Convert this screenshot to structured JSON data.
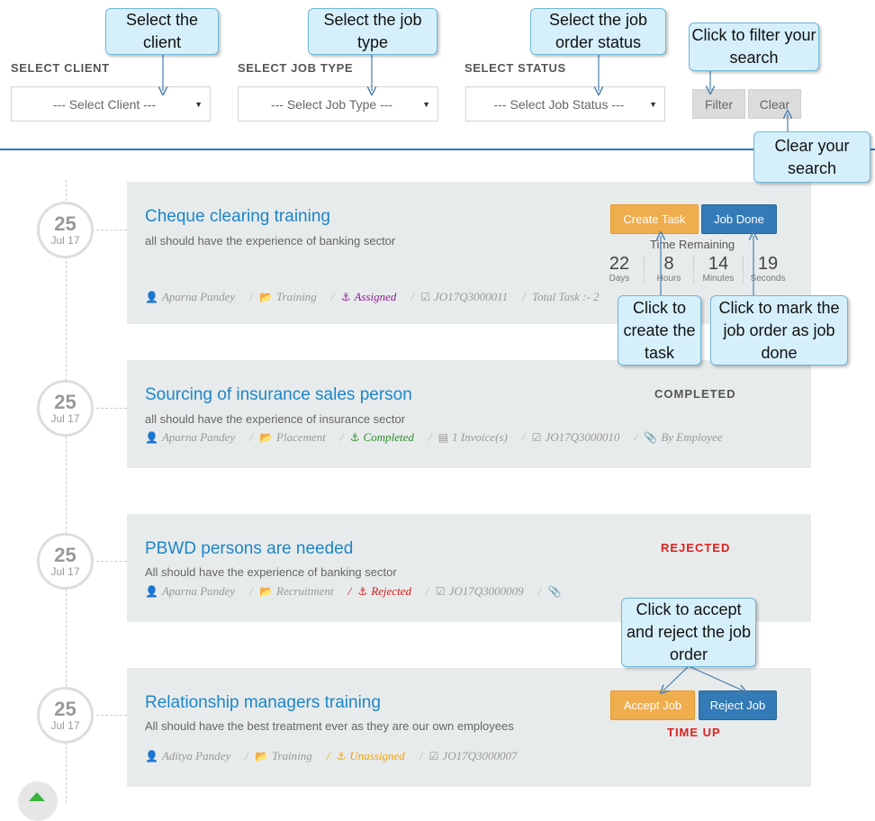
{
  "filters": {
    "client": {
      "label": "SELECT CLIENT",
      "value": "--- Select Client ---"
    },
    "job_type": {
      "label": "SELECT JOB TYPE",
      "value": "--- Select Job Type ---"
    },
    "status": {
      "label": "SELECT STATUS",
      "value": "--- Select Job Status ---"
    },
    "filter_label": "Filter",
    "clear_label": "Clear"
  },
  "callouts": {
    "client": "Select the client",
    "job_type": "Select  the job type",
    "status": "Select  the job order status",
    "filter": "Click to filter your search",
    "clear": "Clear your search",
    "create_task": "Click to create the task",
    "job_done": "Click to mark the job order as job done",
    "accept_reject": "Click to accept and reject the job order"
  },
  "jobs": [
    {
      "day": "25",
      "month": "Jul 17",
      "title": "Cheque clearing training",
      "description": "all should have the experience of banking sector",
      "meta": {
        "person": "Aparna Pandey",
        "type": "Training",
        "status": "Assigned",
        "code": "JO17Q3000011",
        "extra": "Total Task :- 2"
      },
      "status_color": "#8a1f8a",
      "actions": {
        "create_task": "Create Task",
        "job_done": "Job Done"
      },
      "timer": {
        "label": "Time Remaining",
        "units": [
          {
            "value": "22",
            "unit": "Days"
          },
          {
            "value": "8",
            "unit": "Hours"
          },
          {
            "value": "14",
            "unit": "Minutes"
          },
          {
            "value": "19",
            "unit": "Seconds"
          }
        ]
      }
    },
    {
      "day": "25",
      "month": "Jul 17",
      "title": "Sourcing of insurance sales person",
      "description": "all should have the experience of insurance sector",
      "meta": {
        "person": "Aparna Pandey",
        "type": "Placement",
        "status": "Completed",
        "invoice": "1 Invoice(s)",
        "code": "JO17Q3000010",
        "by": "By Employee"
      },
      "status_color": "#2e8b2e",
      "right_status": "COMPLETED",
      "right_status_color": "#555555"
    },
    {
      "day": "25",
      "month": "Jul 17",
      "title": "PBWD persons are needed",
      "description": "All should have the experience of banking sector",
      "meta": {
        "person": "Aparna Pandey",
        "type": "Recruitment",
        "status": "Rejected",
        "code": "JO17Q3000009"
      },
      "status_color": "#d21a1a",
      "right_status": "REJECTED",
      "right_status_color": "#e02020"
    },
    {
      "day": "25",
      "month": "Jul 17",
      "title": "Relationship managers training",
      "description": "All should have the best treatment ever as they are our own employees",
      "meta": {
        "person": "Aditya Pandey",
        "type": "Training",
        "status": "Unassigned",
        "code": "JO17Q3000007"
      },
      "status_color": "#f0a500",
      "actions": {
        "accept": "Accept Job",
        "reject": "Reject Job"
      },
      "right_status": "TIME UP",
      "right_status_color": "#e02020"
    }
  ],
  "icons": [
    "user-icon",
    "folder-icon",
    "anchor-icon",
    "check-square-icon",
    "invoice-icon",
    "paperclip-icon",
    "caret-down-icon"
  ]
}
